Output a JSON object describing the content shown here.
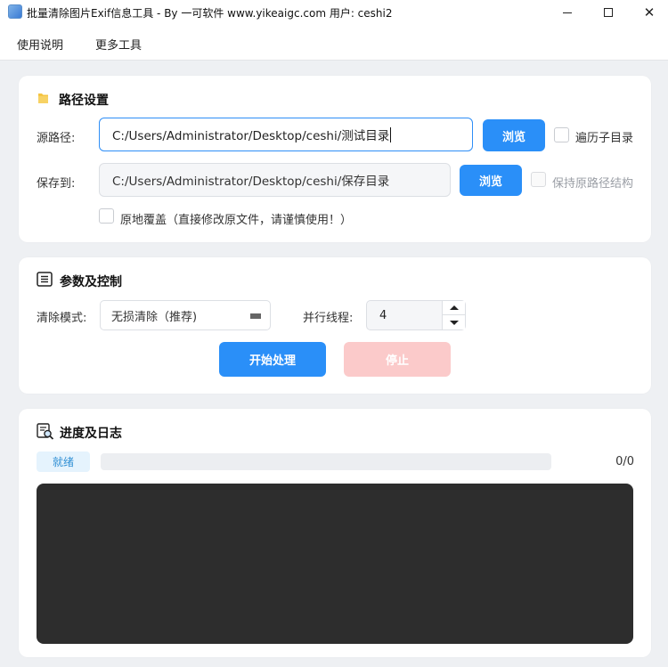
{
  "window": {
    "title": "批量清除图片Exif信息工具 - By 一可软件 www.yikeaigc.com 用户: ceshi2",
    "controls": [
      "minimize-icon",
      "maximize-icon",
      "close-icon"
    ]
  },
  "menu": {
    "items": [
      {
        "label": "使用说明"
      },
      {
        "label": "更多工具"
      }
    ]
  },
  "path_section": {
    "title": "路径设置",
    "icon": "folder-icon",
    "source_label": "源路径:",
    "source_value": "C:/Users/Administrator/Desktop/ceshi/测试目录",
    "source_browse": "浏览",
    "recurse_label": "遍历子目录",
    "recurse_checked": false,
    "save_label": "保存到:",
    "save_value": "C:/Users/Administrator/Desktop/ceshi/保存目录",
    "save_browse": "浏览",
    "keep_structure_label": "保持原路径结构",
    "keep_structure_checked": false,
    "keep_structure_disabled": true,
    "overwrite_label": "原地覆盖（直接修改原文件，请谨慎使用！）",
    "overwrite_checked": false
  },
  "params_section": {
    "title": "参数及控制",
    "icon": "list-icon",
    "mode_label": "清除模式:",
    "mode_value": "无损清除（推荐)",
    "threads_label": "并行线程:",
    "threads_value": "4",
    "start_label": "开始处理",
    "stop_label": "停止",
    "stop_disabled": true
  },
  "progress_section": {
    "title": "进度及日志",
    "icon": "log-search-icon",
    "status": "就绪",
    "progress": 0,
    "count": "0/0"
  },
  "colors": {
    "accent": "#2a8ff8",
    "stop_disabled": "#fbcaca",
    "log_bg": "#2d2d2d",
    "badge_bg": "#e5f3fd",
    "badge_text": "#2f8fd4"
  }
}
